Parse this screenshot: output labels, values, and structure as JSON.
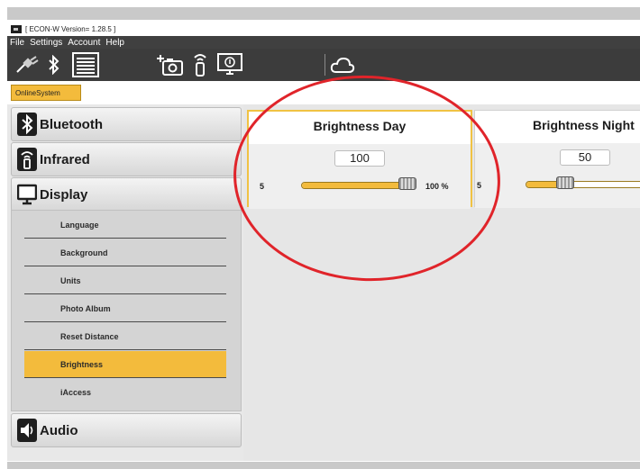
{
  "window": {
    "title": "[ ECON-W Version= 1.28.5 ]"
  },
  "menu": [
    "File",
    "Settings",
    "Account",
    "Help"
  ],
  "toolbar": {
    "icons": [
      "plug-icon",
      "bluetooth-icon",
      "list-icon",
      "add-camera-icon",
      "infrared-icon",
      "display-icon",
      "cloud-icon"
    ]
  },
  "subbar": {
    "tab_label": "OnlineSystem"
  },
  "sidebar": {
    "sections": [
      {
        "label": "Bluetooth",
        "icon": "bluetooth-icon"
      },
      {
        "label": "Infrared",
        "icon": "infrared-icon"
      },
      {
        "label": "Display",
        "icon": "monitor-icon"
      },
      {
        "label": "Audio",
        "icon": "speaker-icon"
      }
    ],
    "display_items": [
      "Language",
      "Background",
      "Units",
      "Photo Album",
      "Reset Distance",
      "Brightness",
      "iAccess"
    ],
    "active_item": "Brightness"
  },
  "brightness": {
    "day": {
      "title": "Brightness Day",
      "value": "100",
      "min_label": "5",
      "max_label": "100 %",
      "level_percent": 100
    },
    "night": {
      "title": "Brightness Night",
      "value": "50",
      "min_label": "5",
      "level_percent": 50
    }
  },
  "colors": {
    "accent": "#f3bb3c",
    "toolbar_bg": "#3c3c3c",
    "annotation": "#e0242a"
  }
}
